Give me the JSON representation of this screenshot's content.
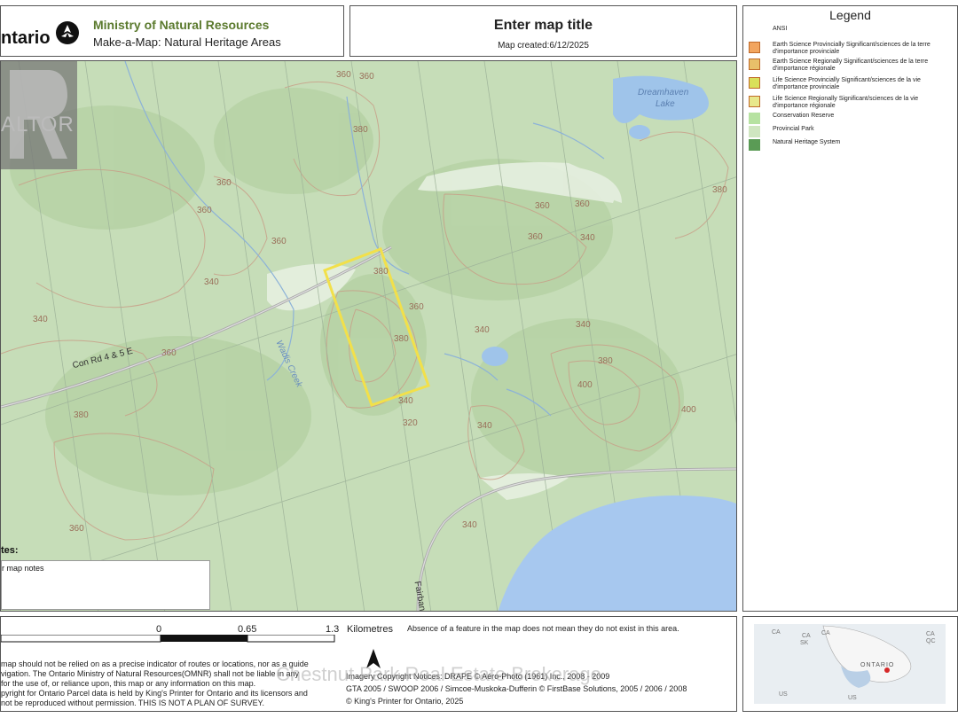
{
  "header": {
    "brand": "ntario",
    "ministry": "Ministry of Natural Resources",
    "product": "Make-a-Map: Natural Heritage Areas",
    "map_title": "Enter map title",
    "map_created": "Map created:6/12/2025"
  },
  "legend": {
    "title": "Legend",
    "group": "ANSI",
    "items": [
      {
        "label": "Earth Science Provincially Significant/sciences de la terre d'importance provinciale",
        "color": "#f2a55f"
      },
      {
        "label": "Earth Science Regionally Significant/sciences de la terre d'importance régionale",
        "color": "#e8c06a"
      },
      {
        "label": "Life Science Provincially Significant/sciences de la vie d'importance provinciale",
        "color": "#d9e05a"
      },
      {
        "label": "Life Science Regionally Significant/sciences de la vie d'importance régionale",
        "color": "#e8e88c"
      },
      {
        "label": "Conservation Reserve",
        "color": "#b6e2a1"
      },
      {
        "label": "Provincial Park",
        "color": "#cfe6c0"
      },
      {
        "label": "Natural Heritage System",
        "color": "#5a9b55"
      }
    ]
  },
  "map": {
    "contours": [
      "360",
      "360",
      "380",
      "360",
      "360",
      "360",
      "340",
      "380",
      "360",
      "360",
      "360",
      "340",
      "340",
      "360",
      "380",
      "400",
      "380",
      "400",
      "340",
      "320",
      "340",
      "380",
      "360",
      "340",
      "360",
      "380",
      "340",
      "340"
    ],
    "roads": [
      "Con Rd 4 & 5 E",
      "Fairban"
    ],
    "creek": "Wadis Creek",
    "lake": [
      "Dreamhaven",
      "Lake"
    ],
    "parcel_color": "#f2e04a"
  },
  "notes": {
    "title": "tes:",
    "text": "r map notes"
  },
  "scale": {
    "ticks": [
      "0",
      "0.65",
      "1.3"
    ],
    "unit": "Kilometres"
  },
  "disclaimer": {
    "lines": [
      "map should not be relied on as a precise indicator of routes or locations, nor as a guide",
      "vigation. The Ontario Ministry of Natural Resources(OMNR) shall not be liable in any",
      "for the use of, or reliance upon, this map or any information on this map.",
      "pyright for Ontario Parcel data is held by King's Printer for Ontario and its licensors and",
      "not be reproduced without permission. THIS IS NOT A PLAN OF SURVEY."
    ]
  },
  "absence_note": "Absence of a feature in the map does not mean they do not exist in this area.",
  "credits": {
    "lines": [
      "Imagery Copyright Notices: DRAPE © Aéro-Photo (1961) Inc., 2008 - 2009",
      "GTA 2005 / SWOOP 2006 / Simcoe-Muskoka-Dufferin © FirstBase Solutions, 2005 / 2006 / 2008",
      "© King's Printer for Ontario, 2025"
    ]
  },
  "watermark": "Chestnut Park Real Estate Brokerage",
  "realtor": "ALTOR",
  "inset": {
    "labels": [
      "CA",
      "CA",
      "CA",
      "SK",
      "CA",
      "QC",
      "ONTARIO",
      "US",
      "US"
    ]
  }
}
